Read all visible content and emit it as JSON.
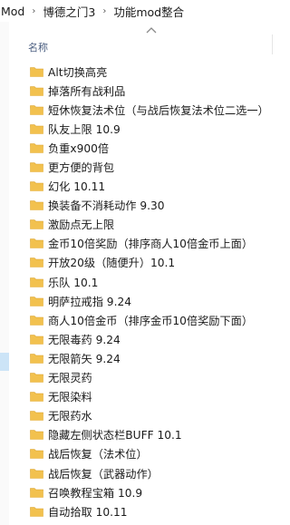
{
  "breadcrumb": {
    "items": [
      "Mod",
      "博德之门3",
      "功能mod整合"
    ],
    "separator": "›"
  },
  "list_header": {
    "name_column": "名称"
  },
  "colors": {
    "folder": "#f2c14e",
    "folder_dark": "#d9a12a",
    "selection": "#cce4f7"
  },
  "files": [
    {
      "name": "Alt切换高亮"
    },
    {
      "name": "掉落所有战利品"
    },
    {
      "name": "短休恢复法术位（与战后恢复法术位二选一）"
    },
    {
      "name": "队友上限 10.9"
    },
    {
      "name": "负重x900倍"
    },
    {
      "name": "更方便的背包"
    },
    {
      "name": "幻化 10.11"
    },
    {
      "name": "换装备不消耗动作 9.30"
    },
    {
      "name": "激励点无上限"
    },
    {
      "name": "金币10倍奖励（排序商人10倍金币上面）"
    },
    {
      "name": "开放20级（随便升）10.1"
    },
    {
      "name": "乐队 10.1"
    },
    {
      "name": "明萨拉戒指 9.24"
    },
    {
      "name": "商人10倍金币（排序金币10倍奖励下面）"
    },
    {
      "name": "无限毒药 9.24"
    },
    {
      "name": "无限箭矢 9.24"
    },
    {
      "name": "无限灵药"
    },
    {
      "name": "无限染料"
    },
    {
      "name": "无限药水"
    },
    {
      "name": "隐藏左侧状态栏BUFF 10.1"
    },
    {
      "name": "战后恢复（法术位）"
    },
    {
      "name": "战后恢复（武器动作）"
    },
    {
      "name": "召唤教程宝箱 10.9"
    },
    {
      "name": "自动拾取 10.11"
    }
  ]
}
